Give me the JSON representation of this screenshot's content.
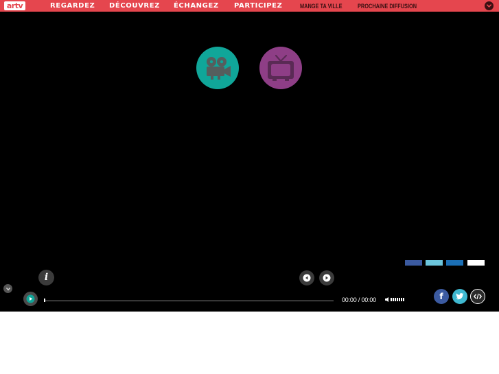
{
  "header": {
    "logo_text": "artv",
    "nav": [
      {
        "label": "REGARDEZ"
      },
      {
        "label": "DÉCOUVREZ"
      },
      {
        "label": "ÉCHANGEZ"
      },
      {
        "label": "PARTICIPEZ"
      }
    ],
    "secondary_nav": [
      {
        "label": "MANGE TA VILLE"
      },
      {
        "label": "PROCHAINE DIFFUSION"
      }
    ],
    "menu_icon": "chevron-down-icon"
  },
  "player": {
    "modes": [
      {
        "icon": "film-camera-icon",
        "color": "#10a699"
      },
      {
        "icon": "television-icon",
        "color": "#8e3e86"
      }
    ],
    "info_label": "i",
    "time": {
      "current": "00:00",
      "separator": " / ",
      "total": "00:00"
    },
    "progress": 0,
    "volume_level": 1.0,
    "share": {
      "facebook_label": "f",
      "icons": [
        "facebook-icon",
        "twitter-icon",
        "embed-code-icon"
      ]
    }
  },
  "colors": {
    "brand": "#e5464e",
    "nav_dark": "#3a1012",
    "film": "#10a699",
    "tv": "#8e3e86",
    "facebook": "#3b5aa0",
    "twitter": "#3fb8d0"
  }
}
